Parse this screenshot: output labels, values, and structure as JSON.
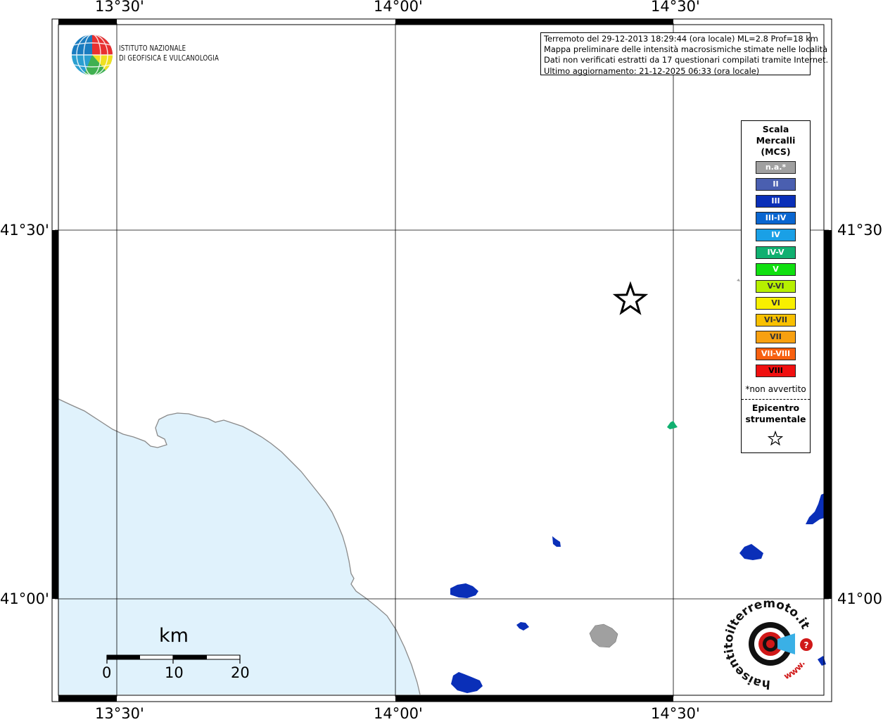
{
  "map": {
    "lon_labels_top": [
      "13°30'",
      "14°00'",
      "14°30'"
    ],
    "lon_labels_bottom": [
      "13°30'",
      "14°00'",
      "14°30'"
    ],
    "lat_labels_left": [
      "41°30'",
      "41°00'"
    ],
    "lat_labels_right": [
      "41°30'",
      "41°00'"
    ],
    "colors": {
      "sea": "#e0f2fc",
      "coast": "#8a8a8a",
      "grid": "#000000",
      "frame": "#000000"
    }
  },
  "infobox": {
    "lines": [
      "Terremoto del 29-12-2013 18:29:44 (ora locale) ML=2.8 Prof=18 km",
      "Mappa preliminare delle intensità macrosismiche stimate nelle località",
      "Dati non verificati estratti da 17 questionari compilati tramite Internet.",
      "Ultimo aggiornamento: 21-12-2025 06:33 (ora locale)"
    ]
  },
  "logo": {
    "line1": "ISTITUTO NAZIONALE",
    "line2": "DI GEOFISICA E VULCANOLOGIA"
  },
  "legend": {
    "title_lines": [
      "Scala",
      "Mercalli",
      "(MCS)"
    ],
    "items": [
      {
        "label": "n.a.*",
        "color": "#a0a0a0"
      },
      {
        "label": "II",
        "color": "#4a5fb0"
      },
      {
        "label": "III",
        "color": "#0a2fb8"
      },
      {
        "label": "III-IV",
        "color": "#0a66d0"
      },
      {
        "label": "IV",
        "color": "#1aa0e6"
      },
      {
        "label": "IV-V",
        "color": "#10b070"
      },
      {
        "label": "V",
        "color": "#10e010"
      },
      {
        "label": "V-VI",
        "color": "#b6f000"
      },
      {
        "label": "VI",
        "color": "#f8f000"
      },
      {
        "label": "VI-VII",
        "color": "#f8c000"
      },
      {
        "label": "VII",
        "color": "#f8a010"
      },
      {
        "label": "VII-VIII",
        "color": "#f86010"
      },
      {
        "label": "VIII",
        "color": "#f01010"
      }
    ],
    "note": "*non avvertito",
    "epicenter_lines": [
      "Epicentro",
      "strumentale"
    ]
  },
  "scalebar": {
    "unit": "km",
    "ticks": [
      "0",
      "10",
      "20"
    ]
  },
  "badge": {
    "text": "haisentitoilterremoto.it",
    "prefix": "www."
  }
}
